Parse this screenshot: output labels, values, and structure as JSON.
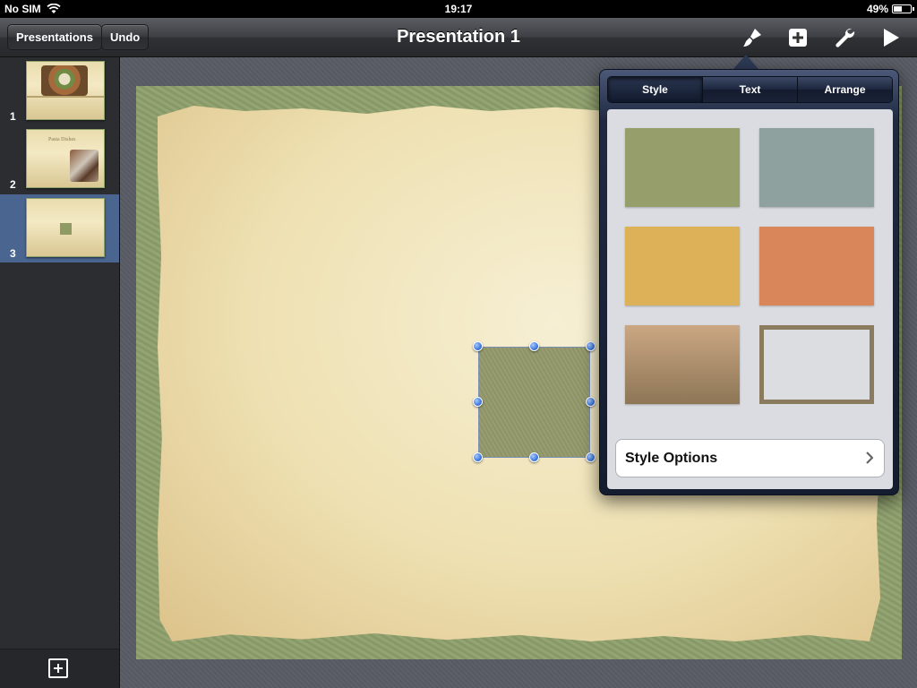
{
  "status": {
    "carrier": "No SIM",
    "time": "19:17",
    "battery": "49%",
    "battery_level": 0.49
  },
  "toolbar": {
    "presentations_label": "Presentations",
    "undo_label": "Undo",
    "title": "Presentation 1"
  },
  "sidebar": {
    "slides": [
      {
        "number": "1"
      },
      {
        "number": "2",
        "title": "Pasta Dishes"
      },
      {
        "number": "3"
      }
    ]
  },
  "popover": {
    "tabs": [
      "Style",
      "Text",
      "Arrange"
    ],
    "active_tab": "Style",
    "swatch_colors": [
      "#969f6c",
      "#8ea19f",
      "#dcb158",
      "#d9875a",
      "#bd9a77",
      "#dcdde1"
    ],
    "style_options_label": "Style Options"
  }
}
